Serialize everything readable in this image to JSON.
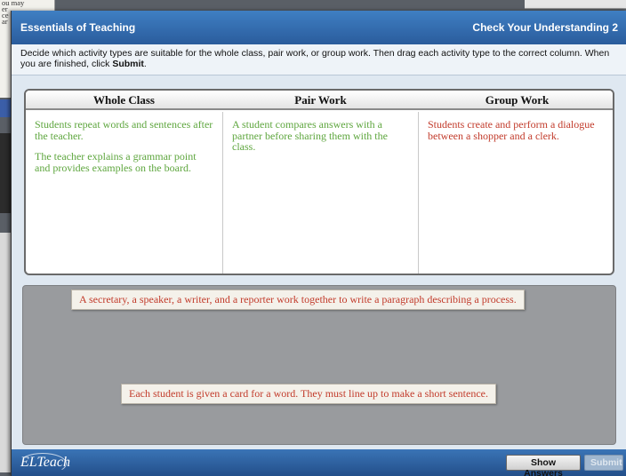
{
  "background": {
    "text_lines": [
      "ou may",
      "er ",
      "ce",
      "ar"
    ]
  },
  "window": {
    "app_title": "Essentials of Teaching",
    "activity_title": "Check Your Understanding 2"
  },
  "instructions": {
    "text_part1": "Decide which activity types are suitable for the whole class, pair work, or group work. Then drag each activity type to the correct column. When you are finished, click ",
    "submit_word": "Submit",
    "text_end": "."
  },
  "columns": [
    {
      "header": "Whole Class",
      "items": [
        {
          "text": "Students repeat words and sentences after the teacher.",
          "status": "correct"
        },
        {
          "text": "The teacher explains a grammar point and provides examples on the board.",
          "status": "correct"
        }
      ]
    },
    {
      "header": "Pair Work",
      "items": [
        {
          "text": "A student compares answers with a partner before sharing them with the class.",
          "status": "correct"
        }
      ]
    },
    {
      "header": "Group Work",
      "items": [
        {
          "text": "Students create and perform a dialogue between a shopper and a clerk.",
          "status": "incorrect"
        }
      ]
    }
  ],
  "drag_items": [
    "A secretary, a speaker, a writer, and a reporter work together to write a paragraph describing a process.",
    "Each student is given a card for a word. They must line up to make a short sentence."
  ],
  "footer": {
    "logo_text": "ELTeach",
    "show_answers_label": "Show Answers",
    "submit_label": "Submit"
  },
  "colors": {
    "correct": "#5ea63e",
    "incorrect": "#c23b2b",
    "titlebar": "#2f6aa9"
  }
}
